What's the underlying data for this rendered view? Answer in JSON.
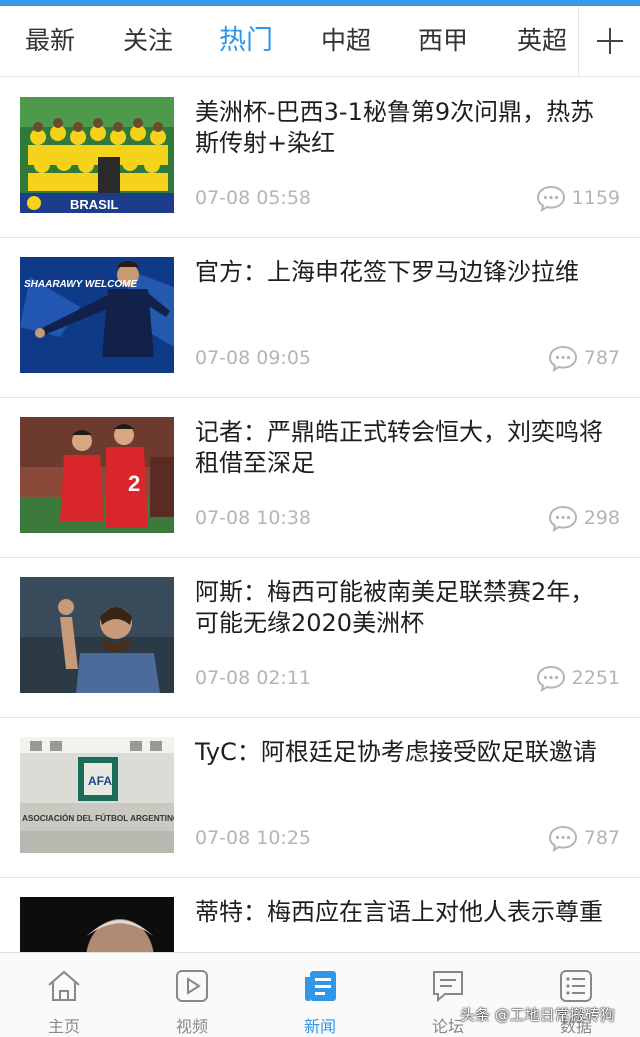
{
  "tabs": [
    "最新",
    "关注",
    "热门",
    "中超",
    "西甲",
    "英超"
  ],
  "active_tab": "热门",
  "news": [
    {
      "title": "美洲杯-巴西3-1秘鲁第9次问鼎，热苏斯传射+染红",
      "time": "07-08 05:58",
      "comments": "1159",
      "thumb_caption": "BRASIL"
    },
    {
      "title": "官方：上海申花签下罗马边锋沙拉维",
      "time": "07-08 09:05",
      "comments": "787",
      "thumb_caption": "SHAARAWY WELCOME"
    },
    {
      "title": "记者：严鼎皓正式转会恒大，刘奕鸣将租借至深足",
      "time": "07-08 10:38",
      "comments": "298",
      "thumb_caption": ""
    },
    {
      "title": "阿斯：梅西可能被南美足联禁赛2年，可能无缘2020美洲杯",
      "time": "07-08 02:11",
      "comments": "2251",
      "thumb_caption": ""
    },
    {
      "title": "TyC：阿根廷足协考虑接受欧足联邀请",
      "time": "07-08 10:25",
      "comments": "787",
      "thumb_caption": "ASOCIACIÓN DEL FÚTBOL ARGENTINO"
    },
    {
      "title": "蒂特：梅西应在言语上对他人表示尊重",
      "time": "",
      "comments": "",
      "thumb_caption": ""
    }
  ],
  "bottom_nav": [
    {
      "label": "主页",
      "icon": "home-icon"
    },
    {
      "label": "视频",
      "icon": "video-icon"
    },
    {
      "label": "新闻",
      "icon": "news-icon"
    },
    {
      "label": "论坛",
      "icon": "forum-icon"
    },
    {
      "label": "数据",
      "icon": "data-icon"
    }
  ],
  "watermark": "头条 @工地日常搬砖狗",
  "colors": {
    "accent": "#2f96e8",
    "meta": "#b5b5b5"
  }
}
